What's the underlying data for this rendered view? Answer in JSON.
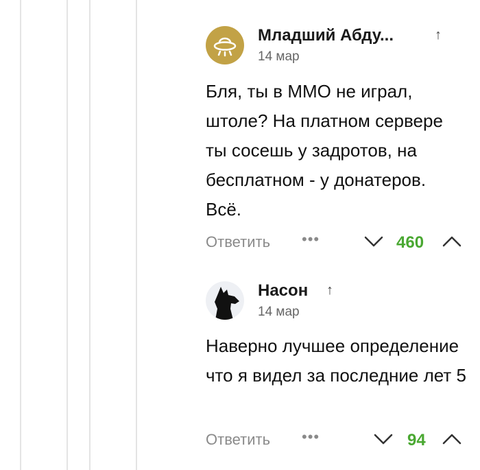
{
  "comments": [
    {
      "author": "Младший Абду...",
      "date": "14 мар",
      "text": "Бля, ты в ММО не играл, штоле? На платном сервере ты сосешь у задротов, на бесплатном - у донатеров. Всё.",
      "reply_label": "Ответить",
      "more_label": "•••",
      "rating": "460",
      "avatar_icon": "ufo-icon",
      "avatar_color": "#c2a246"
    },
    {
      "author": "Насон",
      "date": "14 мар",
      "text": "Наверно лучшее определение что я видел за последние лет 5",
      "reply_label": "Ответить",
      "more_label": "•••",
      "rating": "94",
      "avatar_icon": "wolf-silhouette-icon"
    }
  ],
  "parent_arrow": "↑",
  "colors": {
    "rating": "#4aa832",
    "muted": "#8a8a8a",
    "thread_line": "#e4e4e4"
  }
}
